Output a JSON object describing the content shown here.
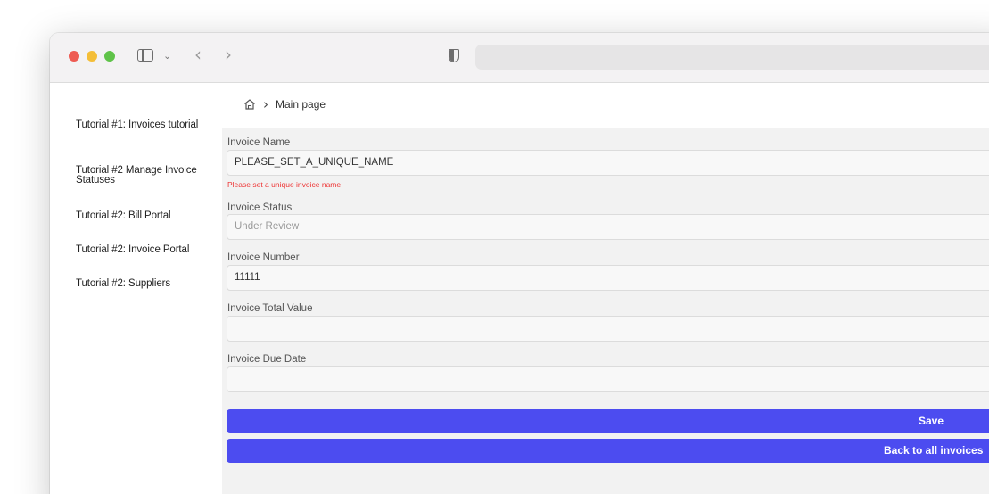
{
  "sidebar": {
    "items": [
      {
        "label": "Tutorial #1: Invoices tutorial"
      },
      {
        "label": "Tutorial #2 Manage Invoice Statuses"
      },
      {
        "label": "Tutorial #2: Bill Portal"
      },
      {
        "label": "Tutorial #2: Invoice Portal"
      },
      {
        "label": "Tutorial #2: Suppliers"
      }
    ]
  },
  "breadcrumb": {
    "icon": "home-icon",
    "separator_icon": "chevron-right-icon",
    "current": "Main page"
  },
  "form": {
    "invoice_name": {
      "label": "Invoice Name",
      "value": "PLEASE_SET_A_UNIQUE_NAME",
      "error": "Please set a unique invoice name"
    },
    "invoice_status": {
      "label": "Invoice Status",
      "value": "Under Review"
    },
    "invoice_number": {
      "label": "Invoice Number",
      "value": "11111"
    },
    "invoice_total_value": {
      "label": "Invoice Total Value",
      "value": ""
    },
    "invoice_due_date": {
      "label": "Invoice Due Date",
      "value": ""
    }
  },
  "buttons": {
    "save": "Save",
    "back": "Back to all invoices"
  },
  "colors": {
    "primary_button": "#4c4cf0",
    "error_text": "#e33333",
    "traffic_red": "#ee5b52",
    "traffic_yellow": "#f4be37",
    "traffic_green": "#5fc349"
  }
}
